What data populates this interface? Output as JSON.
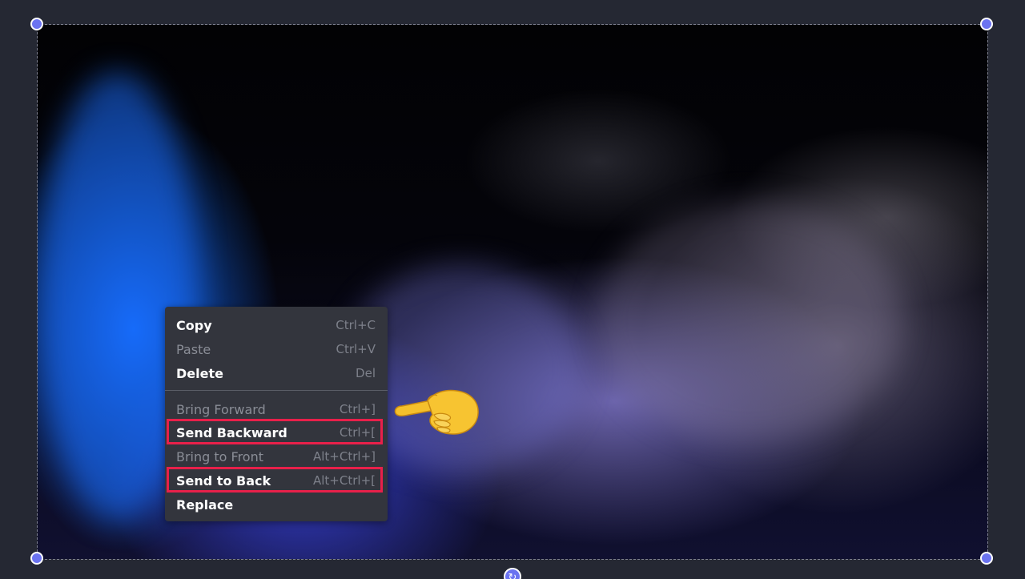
{
  "canvas": {
    "image_description_icon": "smoke-image"
  },
  "context_menu": {
    "items": [
      {
        "label": "Copy",
        "shortcut": "Ctrl+C",
        "enabled": true
      },
      {
        "label": "Paste",
        "shortcut": "Ctrl+V",
        "enabled": false
      },
      {
        "label": "Delete",
        "shortcut": "Del",
        "enabled": true
      },
      {
        "label": "Bring Forward",
        "shortcut": "Ctrl+]",
        "enabled": false
      },
      {
        "label": "Send Backward",
        "shortcut": "Ctrl+[",
        "enabled": true,
        "highlighted": true
      },
      {
        "label": "Bring to Front",
        "shortcut": "Alt+Ctrl+]",
        "enabled": false
      },
      {
        "label": "Send to Back",
        "shortcut": "Alt+Ctrl+[",
        "enabled": true,
        "highlighted": true
      },
      {
        "label": "Replace",
        "shortcut": "",
        "enabled": true
      }
    ]
  },
  "colors": {
    "background": "#252833",
    "menu_background": "#33353d",
    "handle": "#6b73f0",
    "highlight": "#e8204a",
    "hand_emoji": "#f5c02c"
  },
  "icons": {
    "resize_handle": "circle-handle-icon",
    "rotate_handle": "rotate-icon",
    "pointer": "pointing-hand-icon"
  }
}
